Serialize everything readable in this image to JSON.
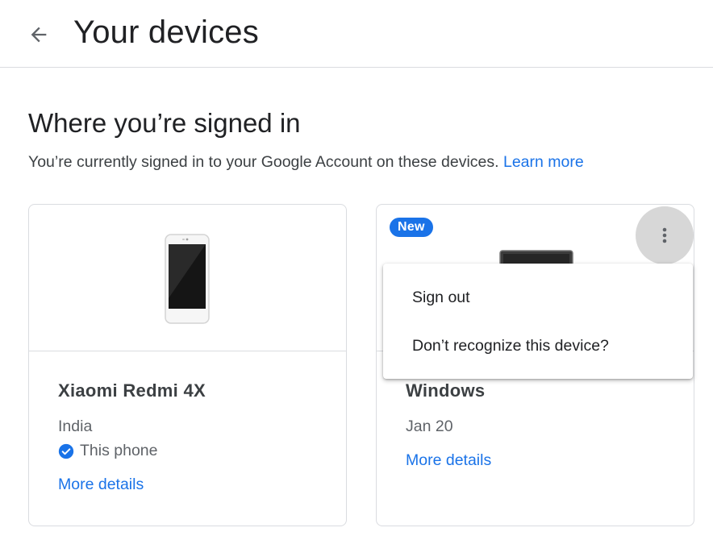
{
  "header": {
    "title": "Your devices",
    "back_icon": "arrow-back-icon"
  },
  "section": {
    "title": "Where you’re signed in",
    "description": "You’re currently signed in to your Google Account on these devices.",
    "learn_more": "Learn more"
  },
  "devices": [
    {
      "name": "Xiaomi Redmi 4X",
      "location": "India",
      "status": "This phone",
      "more_details": "More details",
      "icon": "phone-icon"
    },
    {
      "badge": "New",
      "name": "Windows",
      "date": "Jan 20",
      "more_details": "More details",
      "icon": "laptop-icon"
    }
  ],
  "menu": {
    "items": [
      "Sign out",
      "Don’t recognize this device?"
    ]
  },
  "colors": {
    "accent": "#1a73e8",
    "border": "#dadce0",
    "text": "#202124",
    "secondary_text": "#5f6368"
  }
}
